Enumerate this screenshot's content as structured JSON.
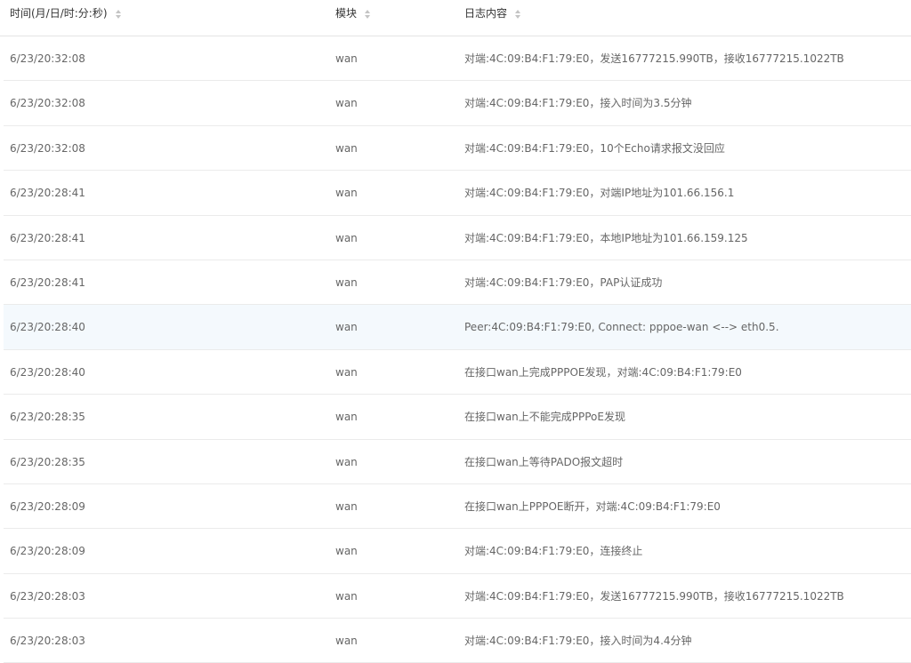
{
  "columns": {
    "time": "时间(月/日/时:分:秒)",
    "module": "模块",
    "content": "日志内容"
  },
  "rows": [
    {
      "time": "6/23/20:32:08",
      "module": "wan",
      "content": "对端:4C:09:B4:F1:79:E0，发送16777215.990TB，接收16777215.1022TB",
      "highlighted": false
    },
    {
      "time": "6/23/20:32:08",
      "module": "wan",
      "content": "对端:4C:09:B4:F1:79:E0，接入时间为3.5分钟",
      "highlighted": false
    },
    {
      "time": "6/23/20:32:08",
      "module": "wan",
      "content": "对端:4C:09:B4:F1:79:E0，10个Echo请求报文没回应",
      "highlighted": false
    },
    {
      "time": "6/23/20:28:41",
      "module": "wan",
      "content": "对端:4C:09:B4:F1:79:E0，对端IP地址为101.66.156.1",
      "highlighted": false
    },
    {
      "time": "6/23/20:28:41",
      "module": "wan",
      "content": "对端:4C:09:B4:F1:79:E0，本地IP地址为101.66.159.125",
      "highlighted": false
    },
    {
      "time": "6/23/20:28:41",
      "module": "wan",
      "content": "对端:4C:09:B4:F1:79:E0，PAP认证成功",
      "highlighted": false
    },
    {
      "time": "6/23/20:28:40",
      "module": "wan",
      "content": "Peer:4C:09:B4:F1:79:E0, Connect: pppoe-wan <--> eth0.5.",
      "highlighted": true
    },
    {
      "time": "6/23/20:28:40",
      "module": "wan",
      "content": "在接口wan上完成PPPOE发现，对端:4C:09:B4:F1:79:E0",
      "highlighted": false
    },
    {
      "time": "6/23/20:28:35",
      "module": "wan",
      "content": "在接口wan上不能完成PPPoE发现",
      "highlighted": false
    },
    {
      "time": "6/23/20:28:35",
      "module": "wan",
      "content": "在接口wan上等待PADO报文超时",
      "highlighted": false
    },
    {
      "time": "6/23/20:28:09",
      "module": "wan",
      "content": "在接口wan上PPPOE断开，对端:4C:09:B4:F1:79:E0",
      "highlighted": false
    },
    {
      "time": "6/23/20:28:09",
      "module": "wan",
      "content": "对端:4C:09:B4:F1:79:E0，连接终止",
      "highlighted": false
    },
    {
      "time": "6/23/20:28:03",
      "module": "wan",
      "content": "对端:4C:09:B4:F1:79:E0，发送16777215.990TB，接收16777215.1022TB",
      "highlighted": false
    },
    {
      "time": "6/23/20:28:03",
      "module": "wan",
      "content": "对端:4C:09:B4:F1:79:E0，接入时间为4.4分钟",
      "highlighted": false
    }
  ],
  "colors": {
    "header_text": "#333333",
    "row_text": "#666666",
    "row_border": "#ebebeb",
    "highlight_bg": "#f4f9fd",
    "sort_icon": "#c4c4c4"
  },
  "icons": {
    "sort": "sort-icon"
  }
}
